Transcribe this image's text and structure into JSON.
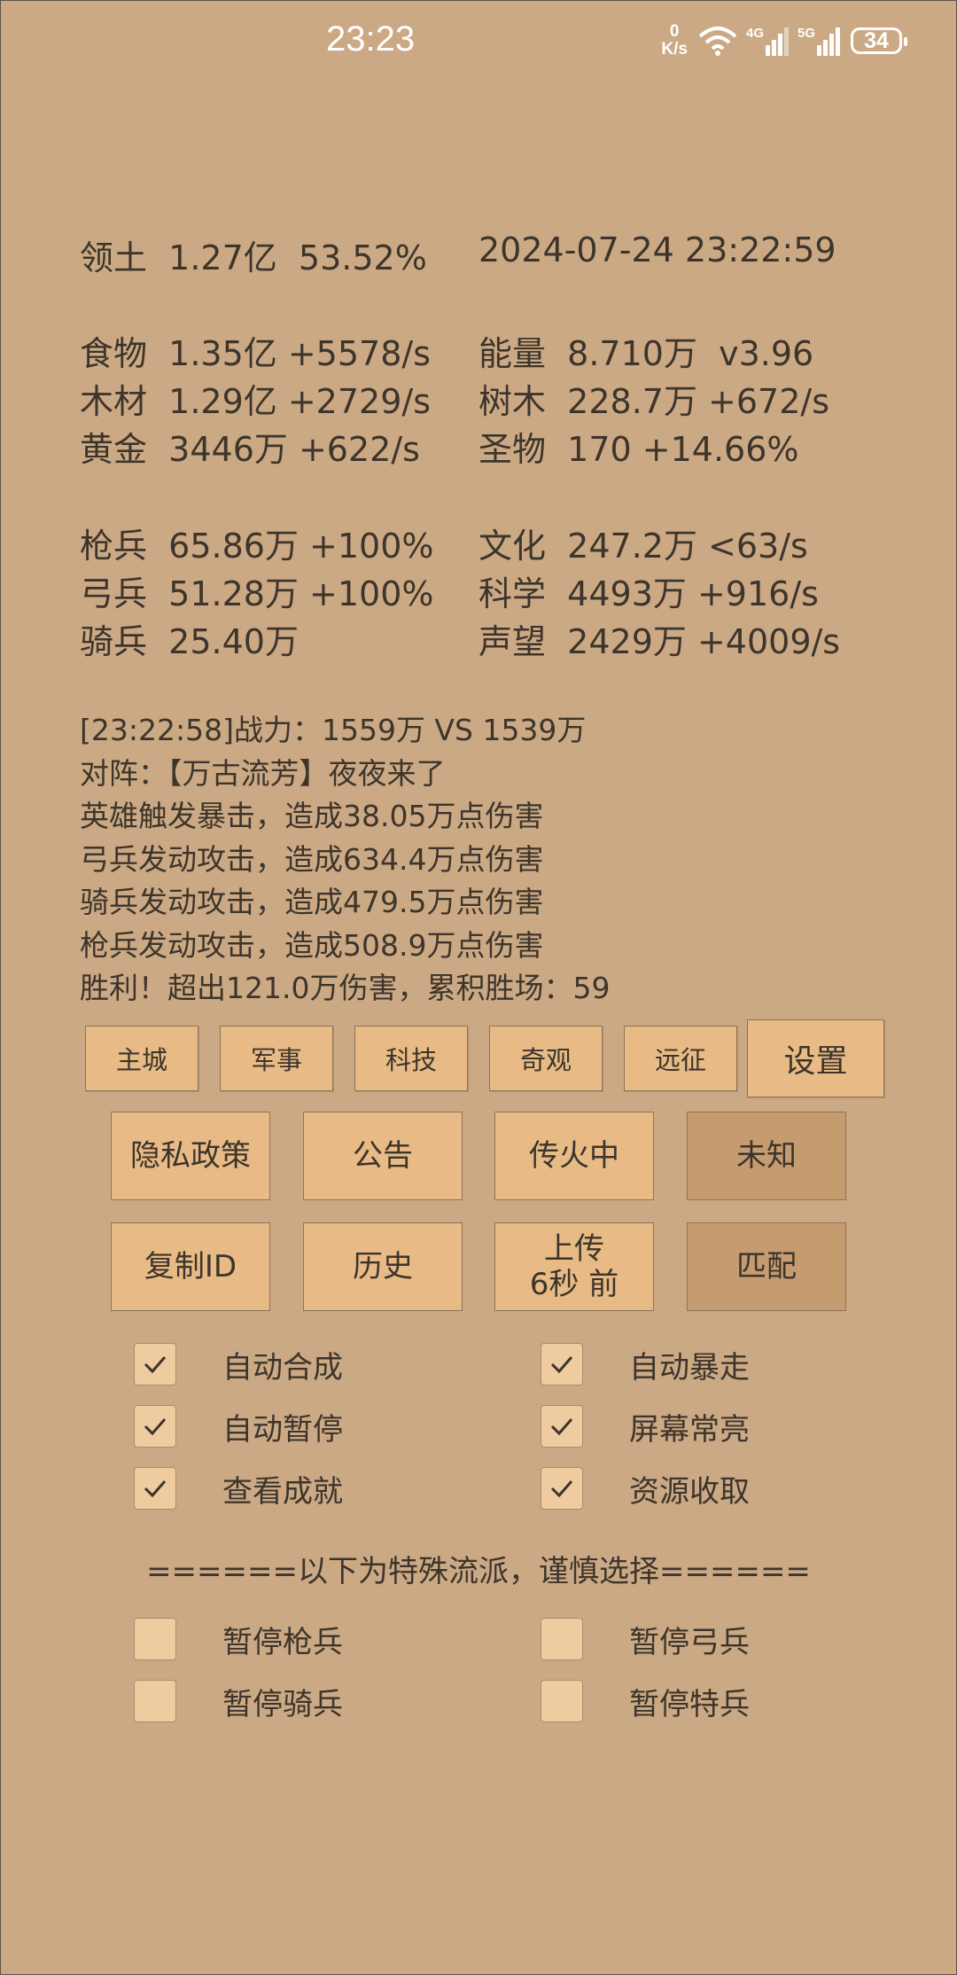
{
  "status_bar": {
    "time": "23:23",
    "net_speed_value": "0",
    "net_speed_unit": "K/s",
    "sim1_label": "4G",
    "sim2_label": "5G",
    "battery": "34"
  },
  "resources": {
    "territory": "领土  1.27亿  53.52%",
    "datetime": "2024-07-24 23:22:59",
    "food": "食物  1.35亿 +5578/s",
    "energy": "能量  8.710万  v3.96",
    "wood": "木材  1.29亿 +2729/s",
    "trees": "树木  228.7万 +672/s",
    "gold": "黄金  3446万 +622/s",
    "relics": "圣物  170 +14.66%",
    "spearmen": "枪兵  65.86万 +100%",
    "culture": "文化  247.2万 <63/s",
    "archers": "弓兵  51.28万 +100%",
    "science": "科学  4493万 +916/s",
    "cavalry": "骑兵  25.40万",
    "prestige": "声望  2429万 +4009/s"
  },
  "battle_log": {
    "line1": "[23:22:58]战力：1559万 VS 1539万",
    "line2": "对阵：【万古流芳】夜夜来了",
    "line3": "英雄触发暴击，造成38.05万点伤害",
    "line4": "弓兵发动攻击，造成634.4万点伤害",
    "line5": "骑兵发动攻击，造成479.5万点伤害",
    "line6": "枪兵发动攻击，造成508.9万点伤害",
    "line7": "胜利！超出121.0万伤害，累积胜场：59"
  },
  "tabs": {
    "main_city": "主城",
    "military": "军事",
    "tech": "科技",
    "wonders": "奇观",
    "expedition": "远征",
    "settings": "设置"
  },
  "buttons": {
    "privacy": "隐私政策",
    "announcement": "公告",
    "torch": "传火中",
    "unknown": "未知",
    "copy_id": "复制ID",
    "history": "历史",
    "upload_line1": "上传",
    "upload_line2": "6秒 前",
    "match": "匹配"
  },
  "options": {
    "auto_merge": "自动合成",
    "auto_rampage": "自动暴走",
    "auto_pause": "自动暂停",
    "screen_on": "屏幕常亮",
    "view_achievements": "查看成就",
    "collect_resources": "资源收取",
    "divider": "======以下为特殊流派，谨慎选择======",
    "pause_spear": "暂停枪兵",
    "pause_archer": "暂停弓兵",
    "pause_cavalry": "暂停骑兵",
    "pause_special": "暂停特兵"
  }
}
